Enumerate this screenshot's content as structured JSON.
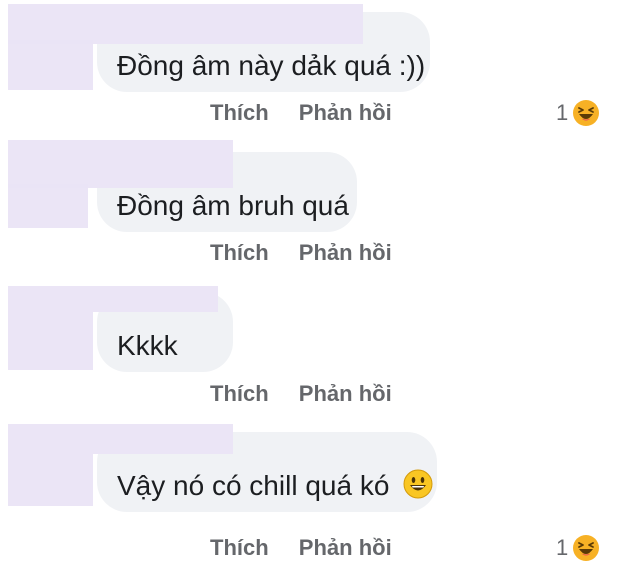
{
  "comments": [
    {
      "text": "Đồng âm này dảk quá :))",
      "like_label": "Thích",
      "reply_label": "Phản hồi",
      "reaction_count": "1",
      "reaction_icon": "laughing-emoji-icon"
    },
    {
      "text": "Đồng âm bruh quá",
      "like_label": "Thích",
      "reply_label": "Phản hồi"
    },
    {
      "text": "Kkkk",
      "like_label": "Thích",
      "reply_label": "Phản hồi"
    },
    {
      "text": "Vậy nó có chill quá kó",
      "inline_emoji": "smiling-emoji-icon",
      "like_label": "Thích",
      "reply_label": "Phản hồi",
      "reaction_count": "1",
      "reaction_icon": "laughing-emoji-icon"
    }
  ],
  "colors": {
    "bubble": "#f0f2f5",
    "text": "#1c1e21",
    "meta": "#65676b",
    "redaction": "#eae4f6"
  }
}
